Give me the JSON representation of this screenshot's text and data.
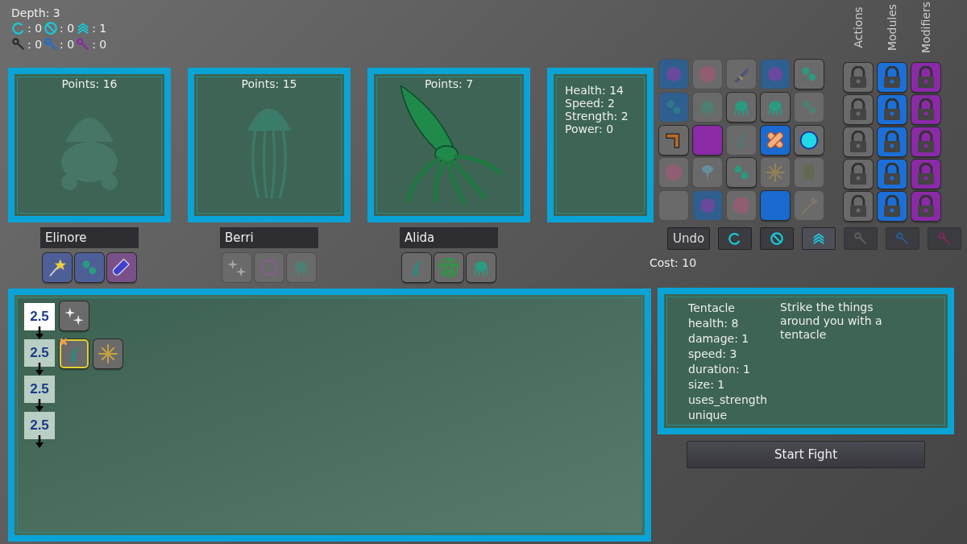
{
  "info": {
    "depth": "Depth: 3",
    "counters": [
      {
        "kind": "loop",
        "color": "#19c8d8",
        "value": ": 0"
      },
      {
        "kind": "block",
        "color": "#19c8d8",
        "value": ": 0"
      },
      {
        "kind": "boost",
        "color": "#19c8d8",
        "value": ": 1"
      },
      {
        "kind": "key",
        "color": "#2c2c2c",
        "value": ": 0"
      },
      {
        "kind": "key",
        "color": "#1c6fd6",
        "value": ": 0"
      },
      {
        "kind": "key",
        "color": "#8a2aa6",
        "value": ": 0"
      }
    ]
  },
  "creatures": [
    {
      "kind": "hermit-crab",
      "points": "Points: 16",
      "dimmed": true,
      "name": "Elinore",
      "items": [
        {
          "kind": "wand",
          "color": "#4e5f98",
          "dimmed": false
        },
        {
          "kind": "blobs",
          "color": "#4e5f98",
          "dimmed": false
        },
        {
          "kind": "potion",
          "color": "#7a5088",
          "dimmed": false
        }
      ]
    },
    {
      "kind": "jellyfish",
      "points": "Points: 15",
      "dimmed": true,
      "name": "Berri",
      "items": [
        {
          "kind": "sparkle",
          "color": "#6a6a6a",
          "dimmed": true
        },
        {
          "kind": "ring",
          "color": "#6a6a6a",
          "dimmed": true
        },
        {
          "kind": "creature",
          "color": "#6a6a6a",
          "dimmed": true
        }
      ]
    },
    {
      "kind": "squid",
      "points": "Points: 7",
      "dimmed": false,
      "name": "Alida",
      "items": [
        {
          "kind": "tentacle",
          "color": "#6a6a6a",
          "dimmed": false
        },
        {
          "kind": "pentagram",
          "color": "#6a6a6a",
          "dimmed": false
        },
        {
          "kind": "creature",
          "color": "#6a6a6a",
          "dimmed": false
        }
      ]
    }
  ],
  "stats": [
    "Health: 14",
    "Speed: 2",
    "Strength: 2",
    "Power: 0"
  ],
  "parts": [
    [
      {
        "kind": "orb",
        "color": "#2f5f8e",
        "dimmed": true
      },
      {
        "kind": "ghost-orb",
        "color": "#6a6a6a",
        "dimmed": true
      },
      {
        "kind": "rocket",
        "color": "#6a6a6a",
        "dimmed": true
      },
      {
        "kind": "orb",
        "color": "#2f5f8e",
        "dimmed": true
      },
      {
        "kind": "blobs",
        "color": "#6a6a6a",
        "dimmed": false
      }
    ],
    [
      {
        "kind": "blobs",
        "color": "#2f5f8e",
        "dimmed": true
      },
      {
        "kind": "creature",
        "color": "#6a6a6a",
        "dimmed": true
      },
      {
        "kind": "creature",
        "color": "#6a6a6a",
        "dimmed": false
      },
      {
        "kind": "creature",
        "color": "#6a6a6a",
        "dimmed": false
      },
      {
        "kind": "blobs",
        "color": "#6a6a6a",
        "dimmed": true
      }
    ],
    [
      {
        "kind": "boomerang",
        "color": "#6a6a6a",
        "dimmed": false
      },
      {
        "kind": "blank",
        "color": "#8a2aa6",
        "dimmed": false
      },
      {
        "kind": "tentacle",
        "color": "#6a6a6a",
        "dimmed": true
      },
      {
        "kind": "bandage",
        "color": "#1a6ad0",
        "dimmed": false
      },
      {
        "kind": "bubble",
        "color": "#6a6a6a",
        "dimmed": false
      }
    ],
    [
      {
        "kind": "ghost-orb",
        "color": "#6a6a6a",
        "dimmed": true
      },
      {
        "kind": "spirit",
        "color": "#6a6a6a",
        "dimmed": true
      },
      {
        "kind": "blobs",
        "color": "#6a6a6a",
        "dimmed": false
      },
      {
        "kind": "sun",
        "color": "#6a6a6a",
        "dimmed": true
      },
      {
        "kind": "barrel",
        "color": "#6a6a6a",
        "dimmed": true
      }
    ],
    [
      {
        "kind": "blank",
        "color": "#6a6a6a",
        "dimmed": true
      },
      {
        "kind": "orb",
        "color": "#2f5f8e",
        "dimmed": true
      },
      {
        "kind": "ghost-orb",
        "color": "#6a6a6a",
        "dimmed": true
      },
      {
        "kind": "blank",
        "color": "#1a6ad0",
        "dimmed": false
      },
      {
        "kind": "spear",
        "color": "#6a6a6a",
        "dimmed": true
      }
    ]
  ],
  "lock_columns": [
    {
      "label": "Actions",
      "color": "#6a6a6a",
      "locks": [
        {
          "locked": true
        },
        {
          "locked": true
        },
        {
          "locked": true
        },
        {
          "locked": true
        },
        {
          "locked": true
        }
      ]
    },
    {
      "label": "Modules",
      "color": "#1c6fd6",
      "locks": [
        {
          "locked": true
        },
        {
          "locked": true
        },
        {
          "locked": true
        },
        {
          "locked": true
        },
        {
          "locked": true
        }
      ]
    },
    {
      "label": "Modifiers",
      "color": "#8a2aa6",
      "locks": [
        {
          "locked": true
        },
        {
          "locked": true
        },
        {
          "locked": true
        },
        {
          "locked": true
        },
        {
          "locked": true
        }
      ]
    }
  ],
  "toolbar": {
    "undo": "Undo",
    "tools": [
      {
        "kind": "loop",
        "color": "#19c8d8",
        "selected": false,
        "disabled": false
      },
      {
        "kind": "block",
        "color": "#19c8d8",
        "selected": false,
        "disabled": false
      },
      {
        "kind": "boost",
        "color": "#19c8d8",
        "selected": true,
        "disabled": false
      },
      {
        "kind": "key",
        "color": "#5c5c5c",
        "selected": false,
        "disabled": true
      },
      {
        "kind": "key",
        "color": "#2a5a8a",
        "selected": false,
        "disabled": true
      },
      {
        "kind": "key",
        "color": "#7a2a5a",
        "selected": false,
        "disabled": true
      }
    ]
  },
  "cost": "Cost: 10",
  "sequence": [
    {
      "value": "2.5",
      "selected": true,
      "parts": [
        {
          "kind": "sparkle",
          "selected": false,
          "marked": false
        }
      ]
    },
    {
      "value": "2.5",
      "selected": false,
      "parts": [
        {
          "kind": "tentacle",
          "selected": true,
          "marked": true
        },
        {
          "kind": "sun",
          "selected": false,
          "marked": false
        }
      ]
    },
    {
      "value": "2.5",
      "selected": false
    },
    {
      "value": "2.5",
      "selected": false
    }
  ],
  "details": {
    "lines": [
      "Tentacle",
      "health: 8",
      "damage: 1",
      "speed: 3",
      "duration: 1",
      "size: 1",
      "uses_strength",
      "unique"
    ],
    "description": "Strike the things around you with a tentacle"
  },
  "start_button": "Start Fight"
}
